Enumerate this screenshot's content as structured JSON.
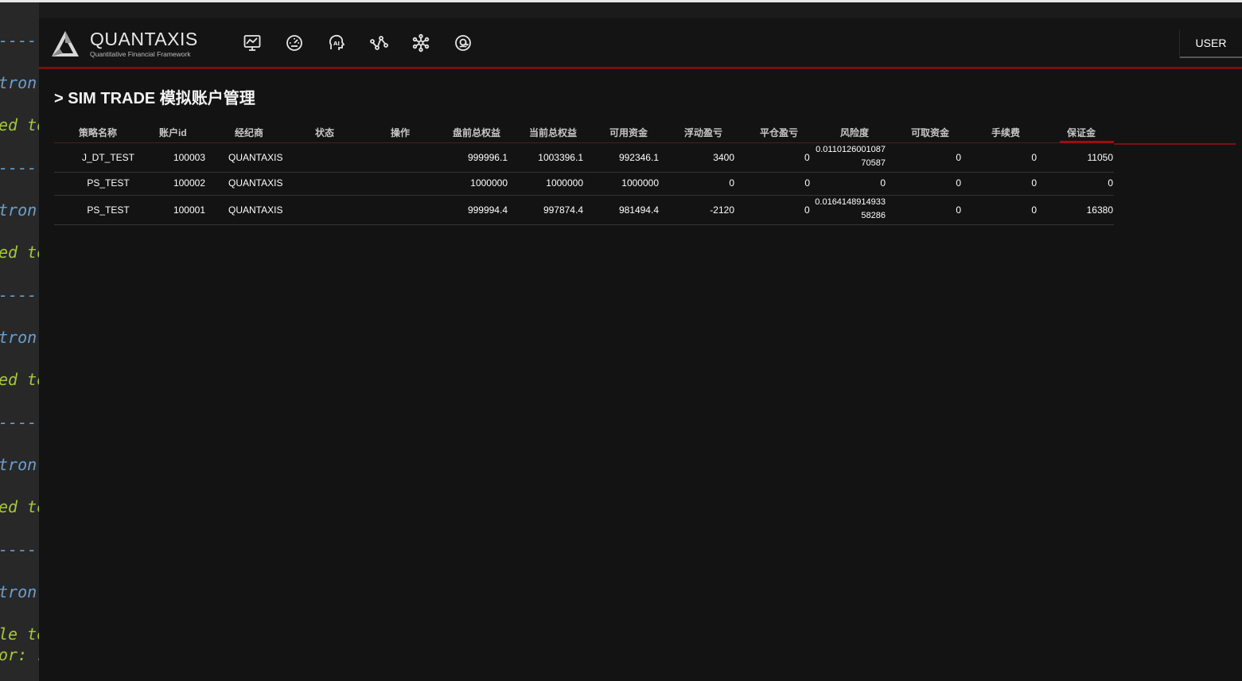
{
  "terminal": {
    "lines": [
      "-----",
      "tron",
      "ed to",
      "-----",
      "tron",
      "ed to",
      "-----",
      "tron",
      "ed to",
      "-----",
      "tron",
      "ed to",
      "-----",
      "tron",
      "le to",
      "or: r"
    ]
  },
  "navbar": {
    "brand_name": "QUANTAXIS",
    "brand_subtitle": "Quantitative Financial Framework",
    "icons": [
      "chart-monitor-icon",
      "dashboard-gauge-icon",
      "ai-head-icon",
      "network-graph-icon",
      "asterisk-hub-icon",
      "at-sign-icon"
    ],
    "user_label": "USER"
  },
  "page": {
    "title": "> SIM TRADE 模拟账户管理"
  },
  "table": {
    "headers": [
      "策略名称",
      "账户id",
      "经纪商",
      "状态",
      "操作",
      "盘前总权益",
      "当前总权益",
      "可用资金",
      "浮动盈亏",
      "平仓盈亏",
      "风险度",
      "可取资金",
      "手续费",
      "保证金"
    ],
    "rows": [
      {
        "strategy": "J_DT_TEST",
        "account_id": "100003",
        "broker": "QUANTAXIS",
        "status": "",
        "action": "",
        "pre_equity": "999996.1",
        "equity": "1003396.1",
        "available": "992346.1",
        "float_pnl": "3400",
        "close_pnl": "0",
        "risk_a": "0.0110126001087",
        "risk_b": "70587",
        "withdrawable": "0",
        "commission": "0",
        "margin": "11050"
      },
      {
        "strategy": "PS_TEST",
        "account_id": "100002",
        "broker": "QUANTAXIS",
        "status": "",
        "action": "",
        "pre_equity": "1000000",
        "equity": "1000000",
        "available": "1000000",
        "float_pnl": "0",
        "close_pnl": "0",
        "risk_a": "0",
        "risk_b": "",
        "withdrawable": "0",
        "commission": "0",
        "margin": "0"
      },
      {
        "strategy": "PS_TEST",
        "account_id": "100001",
        "broker": "QUANTAXIS",
        "status": "",
        "action": "",
        "pre_equity": "999994.4",
        "equity": "997874.4",
        "available": "981494.4",
        "float_pnl": "-2120",
        "close_pnl": "0",
        "risk_a": "0.0164148914933",
        "risk_b": "58286",
        "withdrawable": "0",
        "commission": "0",
        "margin": "16380"
      }
    ]
  },
  "colors": {
    "accent_red": "#7a0f0f",
    "background": "#131313"
  }
}
